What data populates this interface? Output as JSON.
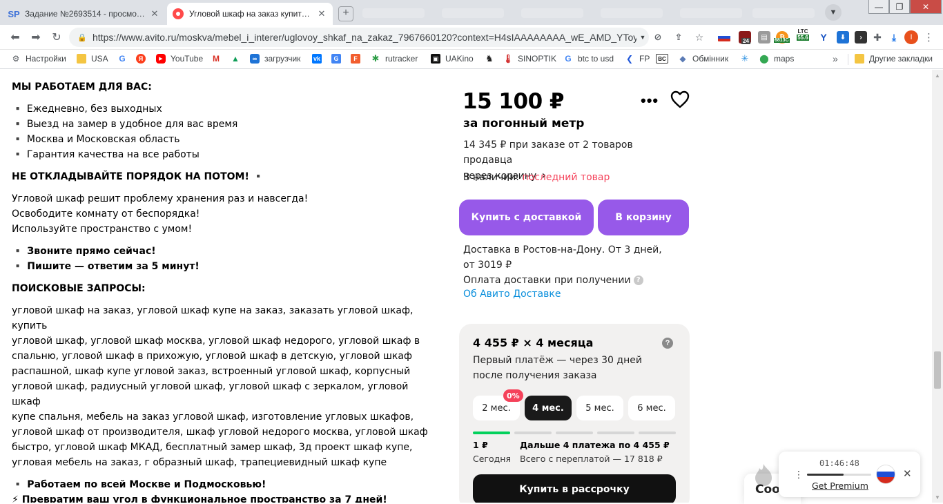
{
  "browser": {
    "tabs": [
      {
        "favicon": "SP",
        "title": "Задание №2693514 - просмотр з",
        "active": false
      },
      {
        "favicon": "avito-icon",
        "title": "Угловой шкаф на заказ купить в г",
        "active": true
      }
    ],
    "new_tab_label": "+",
    "url": "https://www.avito.ru/moskva/mebel_i_interer/uglovoy_shkaf_na_zakaz_7967660120?context=H4sIAAAAAAAA_wE_AMD_YToyO...",
    "toolbar_badges": {
      "ext_24": "24",
      "ext_6813": "6813С",
      "ltc_label": "LTC",
      "ltc_value": "55.6"
    },
    "profile_letter": "I",
    "bookmarks": [
      {
        "label": "Настройки",
        "icon": "gear-icon"
      },
      {
        "label": "USA",
        "icon": "folder-icon"
      },
      {
        "label": "",
        "icon": "google-icon"
      },
      {
        "label": "",
        "icon": "yandex-icon"
      },
      {
        "label": "YouTube",
        "icon": "youtube-icon"
      },
      {
        "label": "",
        "icon": "gmail-icon"
      },
      {
        "label": "",
        "icon": "drive-icon"
      },
      {
        "label": "загрузчик",
        "icon": "loop-icon"
      },
      {
        "label": "",
        "icon": "vk-icon"
      },
      {
        "label": "",
        "icon": "translate-icon"
      },
      {
        "label": "",
        "icon": "f-icon"
      },
      {
        "label": "rutracker",
        "icon": "rutracker-icon"
      },
      {
        "label": "UAKino",
        "icon": "uakino-icon"
      },
      {
        "label": "",
        "icon": "chess-icon"
      },
      {
        "label": "SINOPTIK",
        "icon": "thermometer-icon"
      },
      {
        "label": "btc to usd",
        "icon": "google-icon"
      },
      {
        "label": "FP",
        "icon": "fp-icon"
      },
      {
        "label": "BC",
        "icon": "bc-icon"
      },
      {
        "label": "Обмінник",
        "icon": "exchange-icon"
      },
      {
        "label": "",
        "icon": "star-icon"
      },
      {
        "label": "maps",
        "icon": "maps-icon"
      }
    ],
    "bookmarks_more": "»",
    "other_bookmarks": "Другие закладки"
  },
  "description": {
    "heading_work": "МЫ РАБОТАЕМ ДЛЯ ВАС:",
    "work_items": [
      "▪️ Ежедневно, без выходных",
      "▪️ Выезд на замер в удобное для вас время",
      "▪️ Москва и Московская область",
      "▪️ Гарантия качества на все работы"
    ],
    "heading_delay": "НЕ ОТКЛАДЫВАЙТЕ ПОРЯДОК НА ПОТОМ! ▪️",
    "pitch": [
      "Угловой шкаф решит проблему хранения раз и навсегда!",
      "Освободите комнату от беспорядка!",
      "Используйте пространство с умом!"
    ],
    "call": "▪️ Звоните прямо сейчас!",
    "write": "▪️ Пишите — ответим за 5 минут!",
    "heading_search": "ПОИСКОВЫЕ ЗАПРОСЫ:",
    "search_lines": [
      "угловой шкаф на заказ, угловой шкаф купе на заказ, заказать угловой шкаф, купить",
      "угловой шкаф, угловой шкаф москва, угловой шкаф недорого, угловой шкаф в",
      "спальню, угловой шкаф в прихожую, угловой шкаф в детскую, угловой шкаф",
      "распашной, шкаф купе угловой заказ, встроенный угловой шкаф, корпусный",
      "угловой шкаф, радиусный угловой шкаф, угловой шкаф с зеркалом, угловой шкаф",
      "купе спальня, мебель на заказ угловой шкаф, изготовление угловых шкафов,",
      "угловой шкаф от производителя, шкаф угловой недорого москва, угловой шкаф",
      "быстро, угловой шкаф МКАД, бесплатный замер шкаф, 3д проект шкаф купе,",
      "угловая мебель на заказ, г образный шкаф, трапециевидный шкаф купе"
    ],
    "region": "▪️ Работаем по всей Москве и Подмосковью!",
    "transform": "⚡ Превратим ваш угол в функциональное пространство за 7 дней!"
  },
  "offer": {
    "price": "15 100 ₽",
    "price_unit": "за погонный метр",
    "bulk_line1": "14 345 ₽ при заказе от 2 товаров продавца",
    "bulk_line2": "через корзину",
    "bulk_chevron": "›",
    "availability_label": "В наличии:",
    "availability_value": "последний товар",
    "buy_delivery_button": "Купить с доставкой",
    "cart_button": "В корзину",
    "delivery_line1": "Доставка в Ростов-на-Дону. От 3 дней,",
    "delivery_line2": "от 3019 ₽",
    "payment_line": "Оплата доставки при получении",
    "about_delivery_link": "Об Авито Доставке"
  },
  "installment": {
    "title": "4 455 ₽ × 4 месяца",
    "subtitle_line1": "Первый платёж — через 30 дней",
    "subtitle_line2": "после получения заказа",
    "terms": [
      {
        "label": "2 мес.",
        "badge": "0%",
        "selected": false
      },
      {
        "label": "4 мес.",
        "badge": "",
        "selected": true
      },
      {
        "label": "5 мес.",
        "badge": "",
        "selected": false
      },
      {
        "label": "6 мес.",
        "badge": "",
        "selected": false
      }
    ],
    "first_amount": "1 ₽",
    "first_when": "Сегодня",
    "rest_amount": "Дальше 4 платежа по 4 455 ₽",
    "rest_total": "Всего с переплатой — 17 818 ₽",
    "progress_total_segments": 5,
    "progress_filled_segments": 1,
    "credit_button": "Купить в рассрочку"
  },
  "chat_widget": {
    "text": "Coo"
  },
  "player": {
    "time": "01:46:48",
    "progress_fraction": 0.57,
    "link": "Get Premium"
  },
  "colors": {
    "accent_purple": "#9759e9",
    "alert_red": "#f5425a",
    "link_blue": "#0a8fdc",
    "progress_green": "#02d15c"
  }
}
